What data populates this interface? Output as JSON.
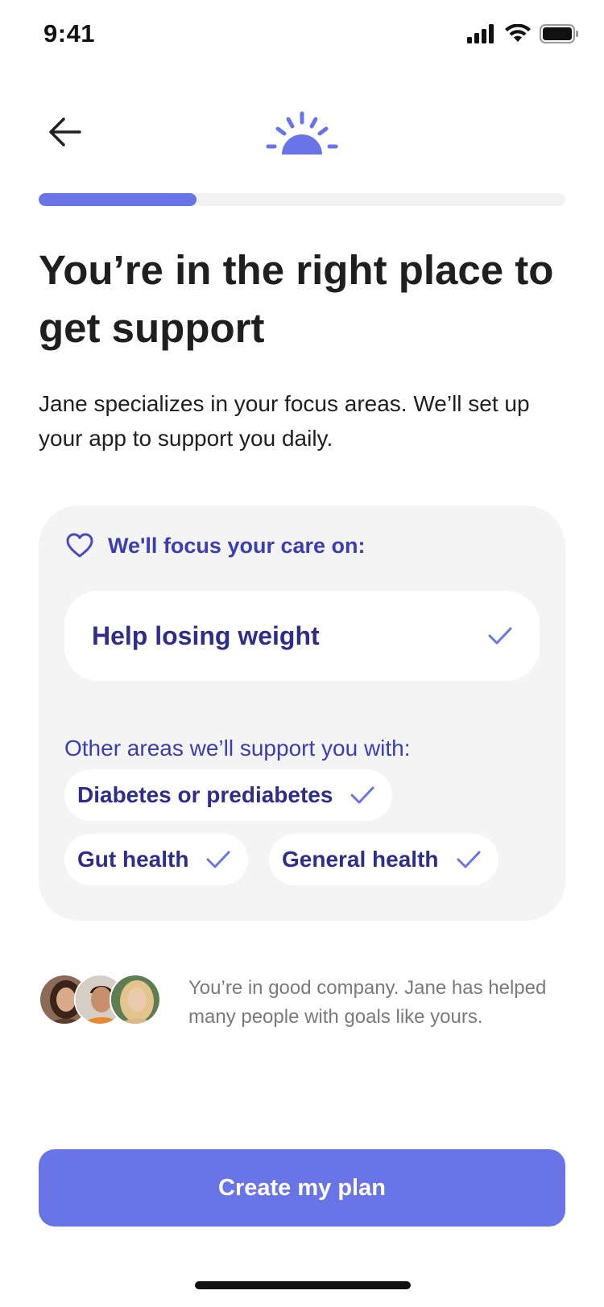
{
  "status_bar": {
    "time": "9:41",
    "icons": [
      "signal-icon",
      "wifi-icon",
      "battery-icon"
    ]
  },
  "nav": {
    "back_icon": "arrow-left-icon",
    "logo_icon": "sunrise-logo"
  },
  "progress": {
    "fraction": 0.3
  },
  "headline": "You’re in the right place to get support",
  "subtext": "Jane specializes in your focus areas. We’ll set up your app to support you daily.",
  "care_card": {
    "header_icon": "heart-icon",
    "header_label": "We'll focus your care on:",
    "primary_focus": {
      "label": "Help losing weight",
      "icon": "check-icon"
    },
    "other_areas_label": "Other areas we’ll support you with:",
    "other_areas": [
      {
        "label": "Diabetes or prediabetes",
        "icon": "check-icon"
      },
      {
        "label": "Gut health",
        "icon": "check-icon"
      },
      {
        "label": "General health",
        "icon": "check-icon"
      }
    ]
  },
  "social_proof": {
    "avatars": [
      "avatar-woman-dark-hair",
      "avatar-man-smiling",
      "avatar-woman-blonde"
    ],
    "text": "You’re in good company. Jane has helped many people with goals like yours."
  },
  "cta": {
    "label": "Create my plan"
  },
  "colors": {
    "accent": "#6974e6",
    "accent_dark": "#3b3db3",
    "chip_text": "#2e2e8a",
    "card_bg": "#f4f4f4"
  }
}
